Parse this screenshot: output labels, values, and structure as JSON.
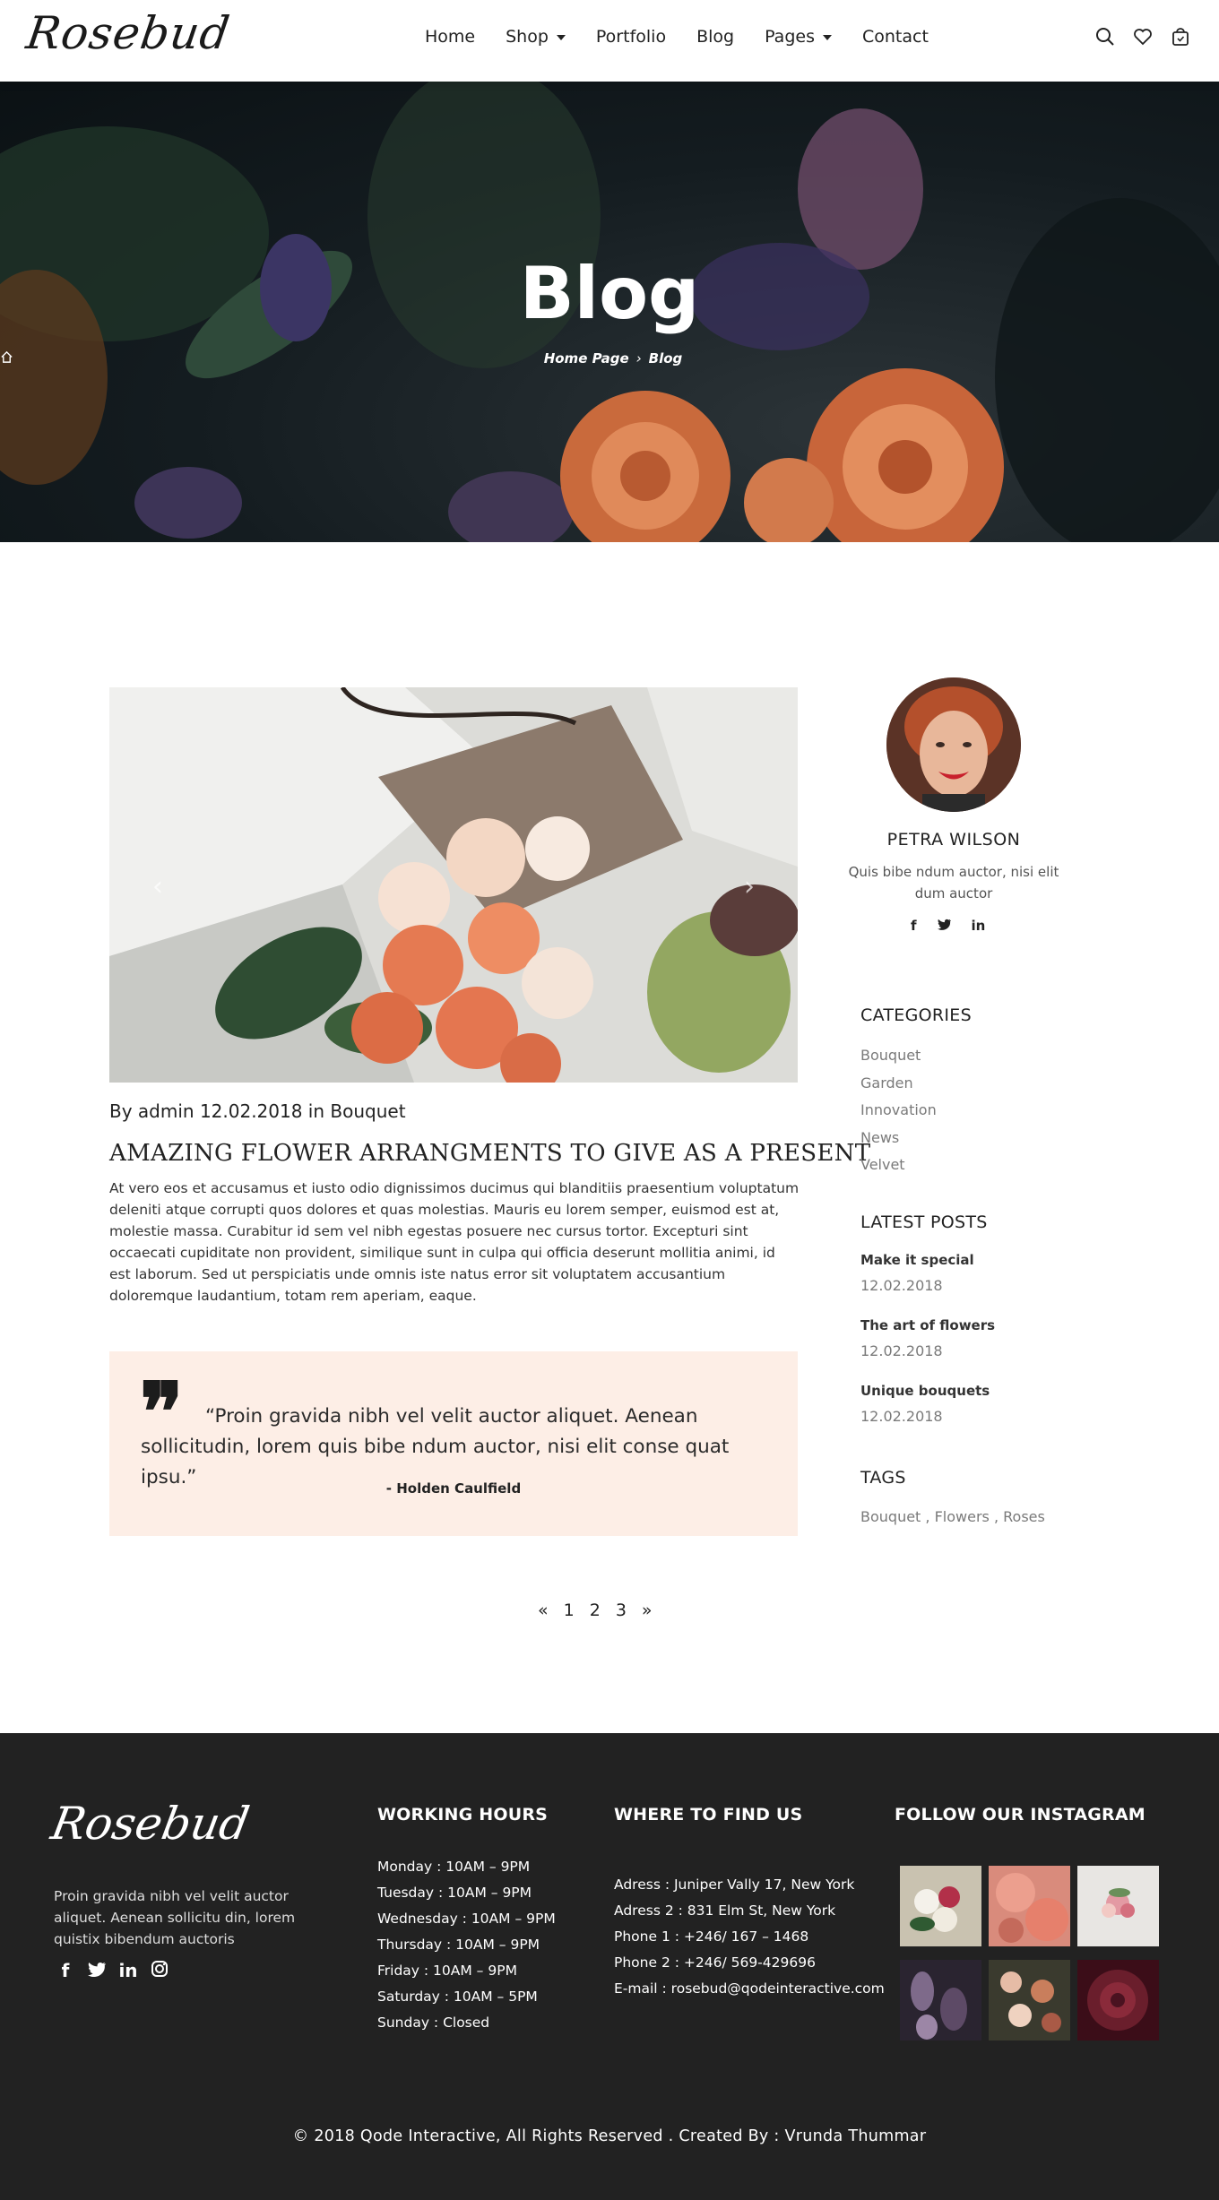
{
  "header": {
    "logo": "Rosebud",
    "nav": [
      {
        "label": "Home",
        "dropdown": false
      },
      {
        "label": "Shop",
        "dropdown": true
      },
      {
        "label": "Portfolio",
        "dropdown": false
      },
      {
        "label": "Blog",
        "dropdown": false
      },
      {
        "label": "Pages",
        "dropdown": true
      },
      {
        "label": "Contact",
        "dropdown": false
      }
    ],
    "icons": [
      "search-icon",
      "heart-icon",
      "shopping-bag-icon"
    ]
  },
  "hero": {
    "title": "Blog",
    "breadcrumb_home": "Home Page",
    "breadcrumb_current": "Blog",
    "breadcrumb_icon": "home-icon"
  },
  "post": {
    "meta": "By admin 12.02.2018 in Bouquet",
    "title": "AMAZING FLOWER ARRANGMENTS TO GIVE AS A PRESENT",
    "body": "At vero eos et accusamus et iusto odio dignissimos ducimus qui blanditiis praesentium voluptatum deleniti atque corrupti quos dolores et quas molestias. Mauris eu lorem semper, euismod est at, molestie massa. Curabitur id sem vel nibh egestas posuere nec cursus tortor. Excepturi sint occaecati cupiditate non provident, similique sunt in culpa qui officia deserunt mollitia animi, id est laborum. Sed ut perspiciatis unde omnis iste natus error sit voluptatem accusantium doloremque laudantium, totam rem aperiam, eaque.",
    "slider_prev": "‹",
    "slider_next": "›"
  },
  "quote": {
    "mark": "❞",
    "text": "“Proin gravida nibh vel velit auctor aliquet. Aenean sollicitudin, lorem quis bibe ndum auctor, nisi elit conse quat ipsu.”",
    "author": "- Holden Caulfield"
  },
  "pagination": [
    "«",
    "1",
    "2",
    "3",
    "»"
  ],
  "sidebar": {
    "author_name": "PETRA WILSON",
    "author_bio": "Quis bibe ndum auctor, nisi elit dum auctor",
    "author_social": [
      "f",
      "🐦",
      "in"
    ],
    "categories_heading": "CATEGORIES",
    "categories": [
      "Bouquet",
      "Garden",
      "Innovation",
      "News",
      "Velvet"
    ],
    "latest_heading": "LATEST POSTS",
    "latest": [
      {
        "title": "Make it special",
        "date": "12.02.2018"
      },
      {
        "title": "The art of flowers",
        "date": "12.02.2018"
      },
      {
        "title": "Unique bouquets",
        "date": "12.02.2018"
      }
    ],
    "tags_heading": "TAGS",
    "tags": [
      "Bouquet",
      "Flowers",
      "Roses"
    ]
  },
  "footer": {
    "logo": "Rosebud",
    "about": "Proin gravida nibh vel velit auctor aliquet. Aenean sollicitu din, lorem quistix bibendum auctoris",
    "social": [
      "f",
      "🐦",
      "in",
      "◎"
    ],
    "hours_heading": "WORKING HOURS",
    "hours": [
      "Monday : 10AM – 9PM",
      "Tuesday : 10AM – 9PM",
      "Wednesday : 10AM – 9PM",
      "Thursday : 10AM – 9PM",
      "Friday : 10AM – 9PM",
      "Saturday : 10AM – 5PM",
      "Sunday : Closed"
    ],
    "find_heading": "WHERE TO FIND US",
    "contact": [
      "Adress : Juniper Vally 17, New York",
      "Adress 2 : 831 Elm St, New York",
      "Phone 1 : +246/ 167 – 1468",
      "Phone 2 : +246/ 569-429696",
      "E-mail : rosebud@qodeinteractive.com"
    ],
    "instagram_heading": "FOLLOW OUR INSTAGRAM",
    "instagram_colors": [
      "#c9c2b0",
      "#d98b7c",
      "#e8e6e3",
      "#5d4a66",
      "#6b6f53",
      "#5a1c28"
    ],
    "copyright": "© 2018 Qode Interactive, All Rights Reserved . Created By : Vrunda Thummar"
  },
  "colors": {
    "quote_bg": "#fdeee6",
    "footer_bg": "#222222",
    "muted_text": "#7a7a7a"
  }
}
